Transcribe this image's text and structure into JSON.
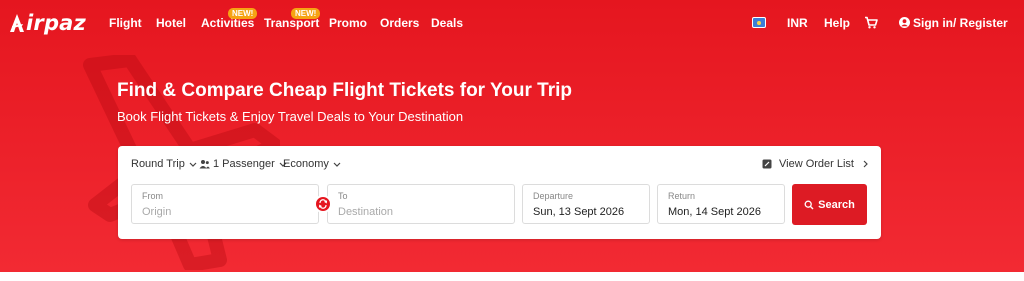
{
  "brand": {
    "logo_text": "irpaz",
    "logo_letter": "A"
  },
  "nav": {
    "items": [
      {
        "label": "Flight"
      },
      {
        "label": "Hotel"
      },
      {
        "label": "Activities",
        "badge": "NEW!"
      },
      {
        "label": "Transport",
        "badge": "NEW!"
      },
      {
        "label": "Promo"
      },
      {
        "label": "Orders"
      },
      {
        "label": "Deals"
      }
    ]
  },
  "header_right": {
    "currency": "INR",
    "help": "Help",
    "signin": "Sign in/ Register"
  },
  "hero": {
    "title": "Find & Compare Cheap Flight Tickets for Your Trip",
    "subtitle": "Book Flight Tickets & Enjoy Travel Deals to Your Destination"
  },
  "search": {
    "trip_type": "Round Trip",
    "passengers": "1 Passenger",
    "cabin_class": "Economy",
    "view_order_list": "View Order List",
    "from": {
      "label": "From",
      "placeholder": "Origin"
    },
    "to": {
      "label": "To",
      "placeholder": "Destination"
    },
    "departure": {
      "label": "Departure",
      "value": "Sun, 13 Sept 2026"
    },
    "return": {
      "label": "Return",
      "value": "Mon, 14 Sept 2026"
    },
    "button": "Search"
  },
  "colors": {
    "brand_red": "#e5161f",
    "badge_orange": "#f6a313",
    "button_red": "#dd1b24"
  }
}
